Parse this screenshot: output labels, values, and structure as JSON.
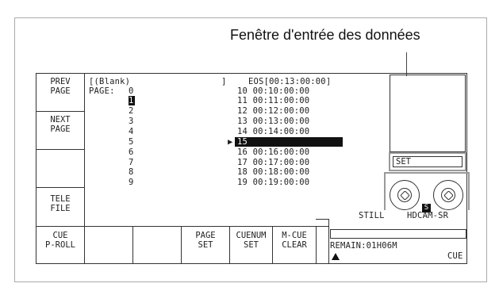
{
  "callout": {
    "label": "Fenêtre d'entrée des données"
  },
  "side_buttons": [
    {
      "line1": "PREV",
      "line2": "PAGE"
    },
    {
      "line1": "NEXT",
      "line2": "PAGE"
    },
    {
      "line1": "",
      "line2": ""
    },
    {
      "line1": "TELE",
      "line2": "FILE"
    }
  ],
  "bottom_buttons": [
    {
      "line1": "CUE",
      "line2": "P-ROLL"
    },
    {
      "line1": "",
      "line2": ""
    },
    {
      "line1": "",
      "line2": ""
    },
    {
      "line1": "PAGE",
      "line2": "SET"
    },
    {
      "line1": "CUENUM",
      "line2": "SET"
    },
    {
      "line1": "M-CUE",
      "line2": "CLEAR"
    }
  ],
  "header": {
    "title": "[(Blank)",
    "close": "]",
    "eos": "EOS[00:13:00:00]",
    "page_label": "PAGE:"
  },
  "pages": [
    "0",
    "1",
    "2",
    "3",
    "4",
    "5",
    "6",
    "7",
    "8",
    "9"
  ],
  "selected_page": "1",
  "cues": [
    {
      "num": "10",
      "time": "00:10:00:00"
    },
    {
      "num": "11",
      "time": "00:11:00:00"
    },
    {
      "num": "12",
      "time": "00:12:00:00"
    },
    {
      "num": "13",
      "time": "00:13:00:00"
    },
    {
      "num": "14",
      "time": "00:14:00:00"
    },
    {
      "num": "15",
      "time": ""
    },
    {
      "num": "16",
      "time": "00:16:00:00"
    },
    {
      "num": "17",
      "time": "00:17:00:00"
    },
    {
      "num": "18",
      "time": "00:18:00:00"
    },
    {
      "num": "19",
      "time": "00:19:00:00"
    }
  ],
  "cursor": "▶",
  "set_field": {
    "label": "SET"
  },
  "tape": {
    "badge": "S"
  },
  "status": {
    "still": "STILL",
    "format": "HDCAM-SR",
    "remain": "REMAIN:01H06M",
    "cue": "CUE"
  },
  "colors": {
    "border": "#333333",
    "highlight": "#111111",
    "callout_frame": "#999999"
  }
}
